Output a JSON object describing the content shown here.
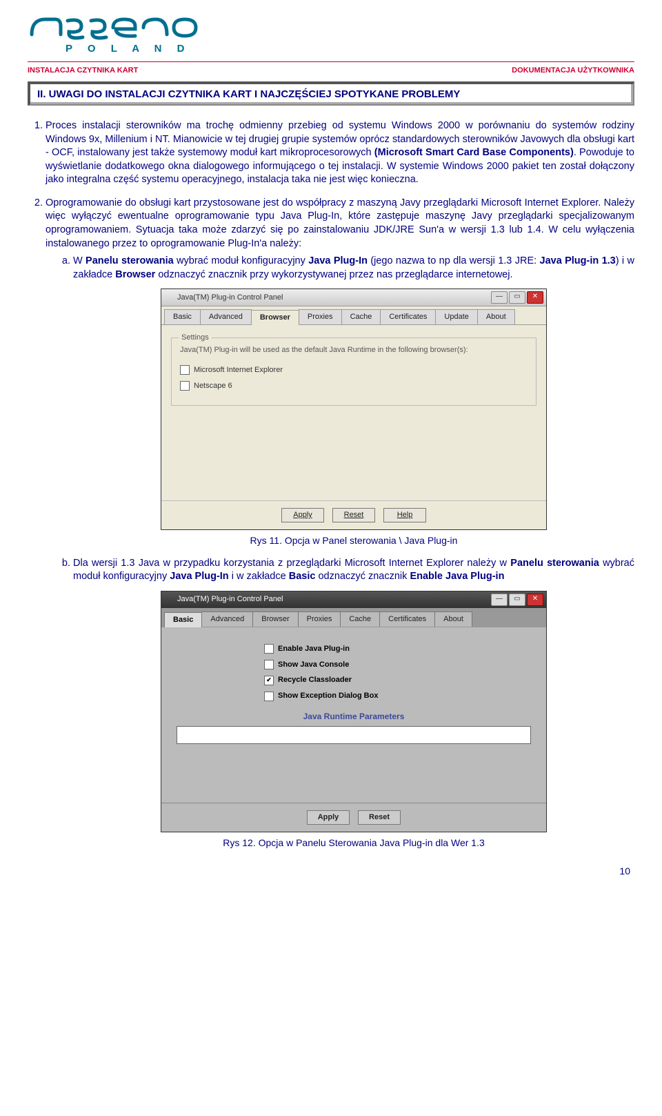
{
  "logo_sub": "P O L A N D",
  "header_left": "INSTALACJA CZYTNIKA KART",
  "header_right": "DOKUMENTACJA UŻYTKOWNIKA",
  "section_title": "II. UWAGI DO INSTALACJI CZYTNIKA KART I NAJCZĘŚCIEJ SPOTYKANE PROBLEMY",
  "para1_a": "Proces instalacji sterowników ma trochę odmienny przebieg od systemu Windows 2000 w porównaniu do systemów rodziny Windows 9x, Millenium i NT. Mianowicie w tej drugiej grupie systemów oprócz standardowych sterowników Javowych dla obsługi kart - OCF, instalowany jest także systemowy moduł kart mikroprocesorowych ",
  "para1_b": "(Microsoft Smart Card Base Components)",
  "para1_c": ". Powoduje to wyświetlanie dodatkowego okna dialogowego informującego o tej instalacji. W systemie Windows 2000 pakiet ten został dołączony jako integralna część systemu operacyjnego, instalacja taka nie jest więc konieczna.",
  "para2_a": "Oprogramowanie do obsługi kart przystosowane jest do współpracy z maszyną Javy przeglądarki Microsoft Internet Explorer. Należy więc wyłączyć ewentualne oprogramowanie typu Java Plug-In, które zastępuje maszynę Javy przeglądarki specjalizowanym oprogramowaniem. Sytuacja taka może zdarzyć się po zainstalowaniu JDK/JRE Sun'a w wersji 1.3 lub 1.4. W celu wyłączenia instalowanego przez to oprogramowanie Plug-In'a należy:",
  "para2_sub_a1": "W ",
  "para2_sub_a2": "Panelu sterowania",
  "para2_sub_a3": " wybrać moduł konfiguracyjny ",
  "para2_sub_a4": "Java Plug-In",
  "para2_sub_a5": " (jego nazwa to np dla wersji 1.3 JRE: ",
  "para2_sub_a6": "Java Plug-in 1.3",
  "para2_sub_a7": ") i w zakładce ",
  "para2_sub_a8": "Browser",
  "para2_sub_a9": " odznaczyć znacznik przy wykorzystywanej przez nas przeglądarce internetowej.",
  "para2_sub_b1": "Dla wersji 1.3 Java w przypadku korzystania z przeglądarki Microsoft Internet Explorer należy w ",
  "para2_sub_b2": "Panelu sterowania",
  "para2_sub_b3": " wybrać moduł konfiguracyjny ",
  "para2_sub_b4": "Java Plug-In",
  "para2_sub_b5": " i w zakładce ",
  "para2_sub_b6": "Basic",
  "para2_sub_b7": " odznaczyć znacznik ",
  "para2_sub_b8": "Enable Java Plug-in",
  "caption1": "Rys 11. Opcja w Panel sterowania \\ Java Plug-in",
  "caption2": "Rys 12. Opcja w Panelu Sterowania Java Plug-in dla Wer 1.3",
  "win1": {
    "title": "Java(TM) Plug-in Control Panel",
    "tabs": [
      "Basic",
      "Advanced",
      "Browser",
      "Proxies",
      "Cache",
      "Certificates",
      "Update",
      "About"
    ],
    "active_tab": "Browser",
    "legend": "Settings",
    "desc": "Java(TM) Plug-in will be used as the default Java Runtime in the following browser(s):",
    "opts": [
      "Microsoft Internet Explorer",
      "Netscape 6"
    ],
    "btns": [
      "Apply",
      "Reset",
      "Help"
    ]
  },
  "win2": {
    "title": "Java(TM) Plug-in Control Panel",
    "tabs": [
      "Basic",
      "Advanced",
      "Browser",
      "Proxies",
      "Cache",
      "Certificates",
      "About"
    ],
    "active_tab": "Basic",
    "opts": [
      {
        "label": "Enable Java Plug-in",
        "checked": false
      },
      {
        "label": "Show Java Console",
        "checked": false
      },
      {
        "label": "Recycle Classloader",
        "checked": true
      },
      {
        "label": "Show Exception Dialog Box",
        "checked": false
      }
    ],
    "param_label": "Java Runtime Parameters",
    "btns": [
      "Apply",
      "Reset"
    ]
  },
  "page_number": "10"
}
